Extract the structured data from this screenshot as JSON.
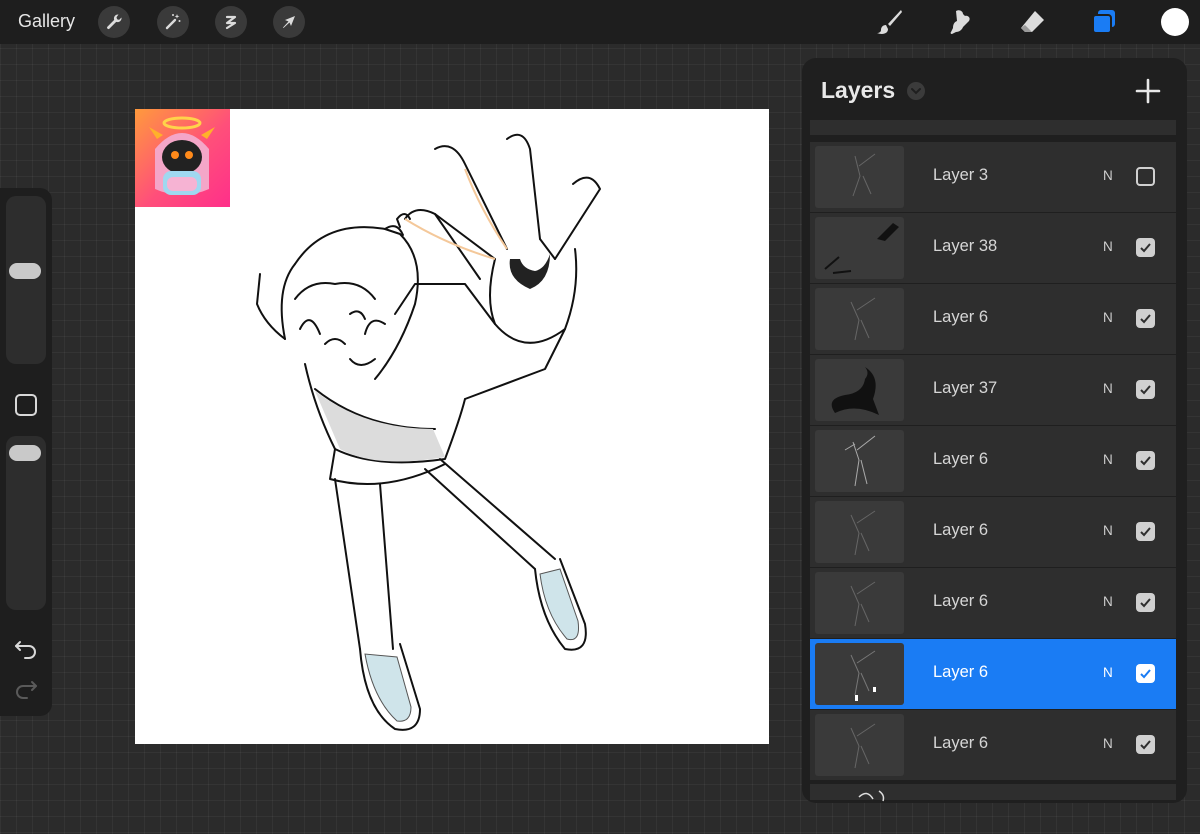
{
  "toolbar": {
    "gallery_label": "Gallery",
    "left_tools": [
      "wrench-icon",
      "magic-wand-icon",
      "selection-icon",
      "transform-arrow-icon"
    ],
    "right_tools": [
      "brush-icon",
      "smudge-icon",
      "eraser-icon",
      "layers-icon"
    ],
    "active_tool": "layers-icon",
    "current_color": "#ffffff",
    "accent_color": "#1a7cf4"
  },
  "sidebar": {
    "brush_size_level": 0.56,
    "opacity_level": 0.6,
    "icons": [
      "modify-square-icon",
      "undo-icon",
      "redo-icon"
    ]
  },
  "layers": {
    "title": "Layers",
    "add_icon": "plus-icon",
    "items": [
      {
        "name": "Layer 3",
        "blend": "N",
        "visible": false,
        "active": false
      },
      {
        "name": "Layer 38",
        "blend": "N",
        "visible": true,
        "active": false
      },
      {
        "name": "Layer 6",
        "blend": "N",
        "visible": true,
        "active": false
      },
      {
        "name": "Layer 37",
        "blend": "N",
        "visible": true,
        "active": false
      },
      {
        "name": "Layer 6",
        "blend": "N",
        "visible": true,
        "active": false
      },
      {
        "name": "Layer 6",
        "blend": "N",
        "visible": true,
        "active": false
      },
      {
        "name": "Layer 6",
        "blend": "N",
        "visible": true,
        "active": true
      },
      {
        "name": "Layer 6",
        "blend": "N",
        "visible": true,
        "active": false
      }
    ]
  }
}
